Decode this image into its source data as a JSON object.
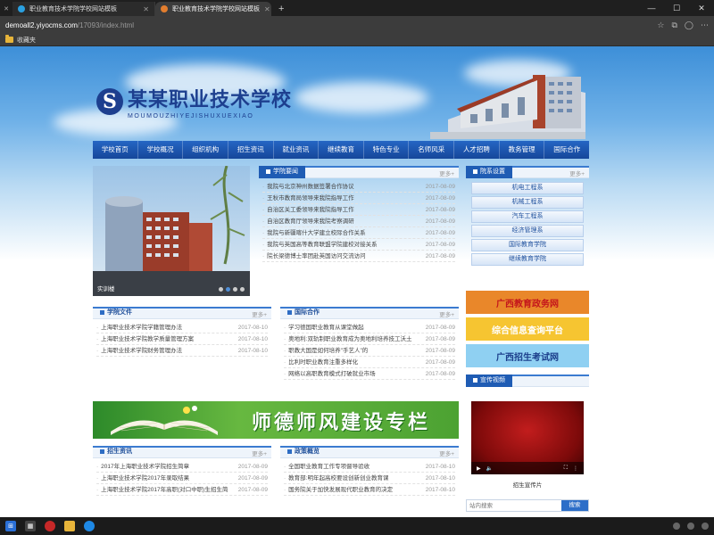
{
  "browser": {
    "tabs": [
      {
        "title": "职业教育技术学院学校网站模板",
        "active": false
      },
      {
        "title": "职业教育技术学院学校网站模板",
        "active": true
      }
    ],
    "url_host": "demoall2.yiyocms.com",
    "url_path": "/17093/index.html",
    "bookmark_folder": "收藏夹"
  },
  "site": {
    "logo_cn": "某某职业技术学校",
    "logo_en": "MOUMOUZHIYEJISHUXUEXIAO",
    "nav": [
      "学校首页",
      "学校概况",
      "组织机构",
      "招生资讯",
      "就业资讯",
      "继续教育",
      "特色专业",
      "名师风采",
      "人才招聘",
      "教务管理",
      "国际合作"
    ],
    "slider": {
      "caption": "实训楼",
      "dots": 4,
      "active_dot": 1
    },
    "news": {
      "title": "学院要闻",
      "more": "更多+",
      "items": [
        {
          "t": "我院与北京神州数据签署合作协议",
          "d": "2017-08-09"
        },
        {
          "t": "王秋市教育局领导来我院指导工作",
          "d": "2017-08-09"
        },
        {
          "t": "自治区关工委领导来我院指导工作",
          "d": "2017-08-09"
        },
        {
          "t": "自治区教育厅领导来我院考察调研",
          "d": "2017-08-09"
        },
        {
          "t": "我院与新疆喀什大学建立校际合作关系",
          "d": "2017-08-09"
        },
        {
          "t": "我院与英国高等教育联盟学院建校对接关系",
          "d": "2017-08-09"
        },
        {
          "t": "院长梁德博士率团赴英国访问交流访问",
          "d": "2017-08-09"
        }
      ]
    },
    "depts": {
      "title": "院系设置",
      "more": "更多+",
      "items": [
        "机电工程系",
        "机械工程系",
        "汽车工程系",
        "经济管理系",
        "国际教育学院",
        "继续教育学院"
      ]
    },
    "docs": {
      "title": "学院文件",
      "more": "更多+",
      "items": [
        {
          "t": "上海职业技术学院学籍管理办法",
          "d": "2017-08-10"
        },
        {
          "t": "上海职业技术学院教学质量管理方案",
          "d": "2017-08-10"
        },
        {
          "t": "上海职业技术学院财务管理办法",
          "d": "2017-08-10"
        }
      ]
    },
    "intl": {
      "title": "国际合作",
      "more": "更多+",
      "items": [
        {
          "t": "学习德国职业教育从课堂做起",
          "d": "2017-08-09"
        },
        {
          "t": "奥地利:双轨制职业教育成为奥地利培养技工沃土",
          "d": "2017-08-09"
        },
        {
          "t": "职教大国是如何培养\"手艺人\"的",
          "d": "2017-08-09"
        },
        {
          "t": "比利时职业教育注重多样化",
          "d": "2017-08-09"
        },
        {
          "t": "网络以高职教育模式打破就业市场",
          "d": "2017-08-09"
        }
      ]
    },
    "links": [
      {
        "label": "广西教育政务网",
        "bg": "#e9872a",
        "fg": "#c4161c"
      },
      {
        "label": "综合信息查询平台",
        "bg": "#f6c531",
        "fg": "#ffffff"
      },
      {
        "label": "广西招生考试网",
        "bg": "#8fd0f2",
        "fg": "#1a3c8a"
      }
    ],
    "banner_text": "师德师风建设专栏",
    "video": {
      "title": "宣传视频",
      "caption": "招生宣传片"
    },
    "admissions": {
      "title": "招生资讯",
      "more": "更多+",
      "items": [
        {
          "t": "2017年上海职业技术学院招生简章",
          "d": "2017-08-09"
        },
        {
          "t": "上海职业技术学院2017年录取结果",
          "d": "2017-08-09"
        },
        {
          "t": "上海职业技术学院2017年高职(对口中职)生招生简",
          "d": "2017-08-09"
        }
      ]
    },
    "policy": {
      "title": "政策概览",
      "more": "更多+",
      "items": [
        {
          "t": "全国职业教育工作专项督导验收",
          "d": "2017-08-10"
        },
        {
          "t": "教育部:明年起高校要设创新创业教育课",
          "d": "2017-08-10"
        },
        {
          "t": "国务院关于加快发展现代职业教育的决定",
          "d": "2017-08-10"
        }
      ]
    },
    "search_placeholder": "站内搜索",
    "search_button": "搜索"
  }
}
